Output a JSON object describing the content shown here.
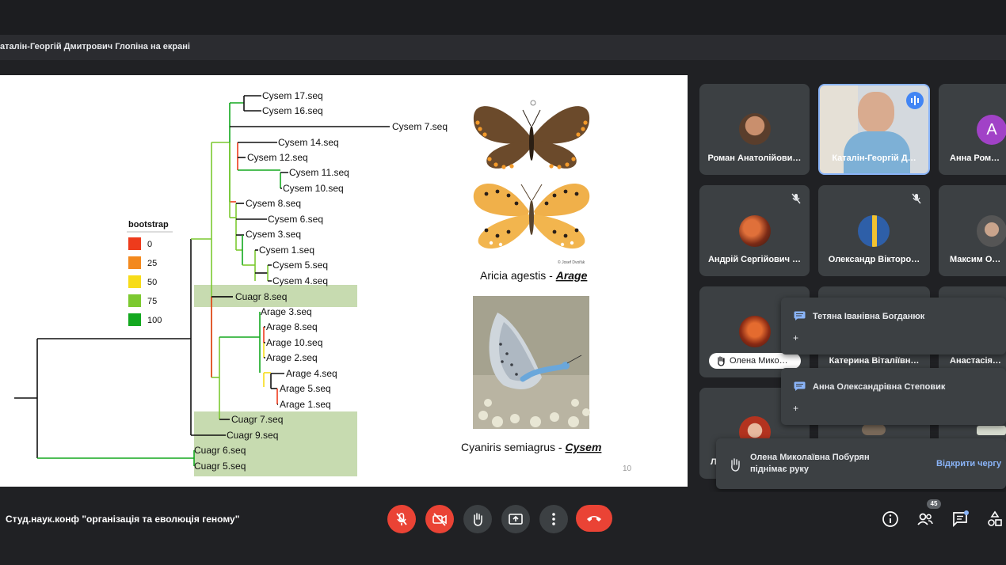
{
  "presenter_banner": "аталін-Георгій Дмитрович Глопіна на екрані",
  "slide": {
    "legend": {
      "title": "bootstrap",
      "items": [
        {
          "label": "0",
          "color": "#ee3b1c"
        },
        {
          "label": "25",
          "color": "#f3891e"
        },
        {
          "label": "50",
          "color": "#f7dc19"
        },
        {
          "label": "75",
          "color": "#7cc930"
        },
        {
          "label": "100",
          "color": "#13a81f"
        }
      ]
    },
    "leaves": {
      "cysem17": "Cysem 17.seq",
      "cysem16": "Cysem 16.seq",
      "cysem7": "Cysem 7.seq",
      "cysem14": "Cysem 14.seq",
      "cysem12": "Cysem 12.seq",
      "cysem11": "Cysem 11.seq",
      "cysem10": "Cysem 10.seq",
      "cysem8": "Cysem 8.seq",
      "cysem6": "Cysem 6.seq",
      "cysem3": "Cysem 3.seq",
      "cysem1": "Cysem 1.seq",
      "cysem5": "Cysem 5.seq",
      "cysem4": "Cysem 4.seq",
      "cuagr8": "Cuagr 8.seq",
      "arage3": "Arage 3.seq",
      "arage8": "Arage 8.seq",
      "arage10": "Arage 10.seq",
      "arage2": "Arage 2.seq",
      "arage4": "Arage 4.seq",
      "arage5": "Arage 5.seq",
      "arage1": "Arage 1.seq",
      "cuagr7": "Cuagr 7.seq",
      "cuagr9": "Cuagr 9.seq",
      "cuagr6": "Cuagr 6.seq",
      "cuagr5": "Cuagr 5.seq"
    },
    "photo_credit": "© Josef Dvořák",
    "caption1_species": "Aricia agestis - ",
    "caption1_code": "Arage",
    "caption2_species": "Cyaniris semiagrus - ",
    "caption2_code": "Cysem",
    "page_number": "10"
  },
  "participants": [
    {
      "name": "Роман Анатолійови…",
      "muted": false
    },
    {
      "name": "Каталін-Георгій Д…",
      "speaking": true
    },
    {
      "name": "Анна Романів",
      "initial": "A",
      "muted": false
    },
    {
      "name": "Андрій Сергійович …",
      "muted": true
    },
    {
      "name": "Олександр Вікторо…",
      "muted": true
    },
    {
      "name": "Максим Олек",
      "muted": false
    },
    {
      "name": "Катерина Віталіївн…"
    },
    {
      "name": "Анастасія Вал"
    },
    {
      "name": "Ль"
    }
  ],
  "hand_chip": "Олена Мико…",
  "popups": [
    {
      "name": "Тетяна Іванівна Богданюк",
      "plus": "+"
    },
    {
      "name": "Анна Олександрівна Степовик",
      "plus": "+"
    }
  ],
  "toast": {
    "text": "Олена Миколаївна Побурян піднімає руку",
    "action": "Відкрити чергу"
  },
  "meeting_title": "Студ.наук.конф \"організація та еволюція геному\"",
  "participant_count": "45",
  "colors": {
    "accent": "#8ab4f8",
    "danger": "#ea4335",
    "speaking": "#4285f4"
  }
}
